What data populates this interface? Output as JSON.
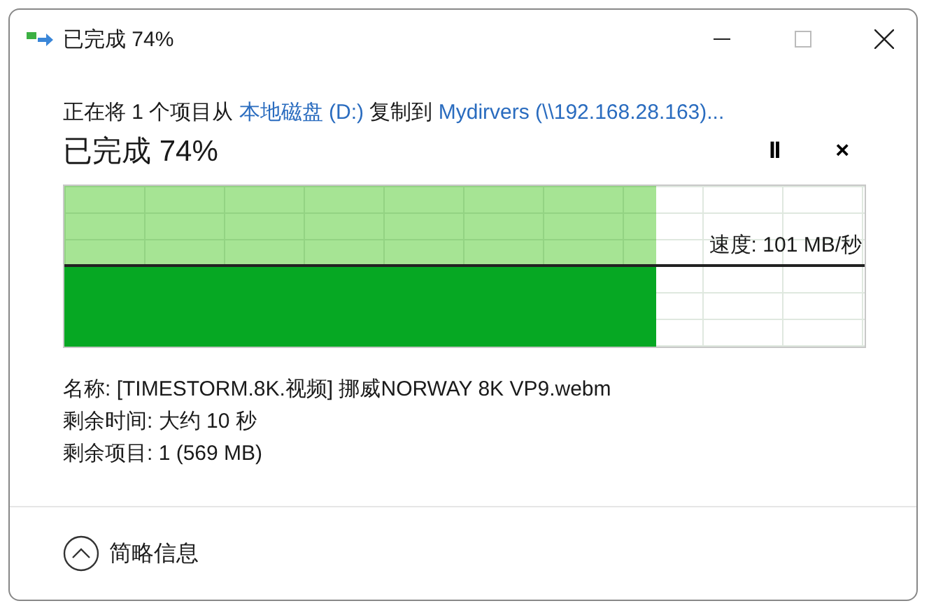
{
  "window": {
    "title": "已完成 74%"
  },
  "description": {
    "prefix": "正在将 1 个项目从 ",
    "source": "本地磁盘 (D:)",
    "middle": " 复制到 ",
    "destination": "Mydirvers (\\\\192.168.28.163)..."
  },
  "status": "已完成 74%",
  "controls": [
    {
      "kind": "pause",
      "label": "II"
    },
    {
      "kind": "cancel",
      "label": "×"
    }
  ],
  "progress": {
    "level": 0.74,
    "speed": "速度: 101 MB/秒"
  },
  "details": [
    "名称: [TIMESTORM.8K.视频] 挪威NORWAY 8K VP9.webm",
    "剩余时间: 大约 10 秒",
    "剩余项目: 1 (569 MB)"
  ],
  "footer": {
    "label": "简略信息",
    "expanded": true
  }
}
